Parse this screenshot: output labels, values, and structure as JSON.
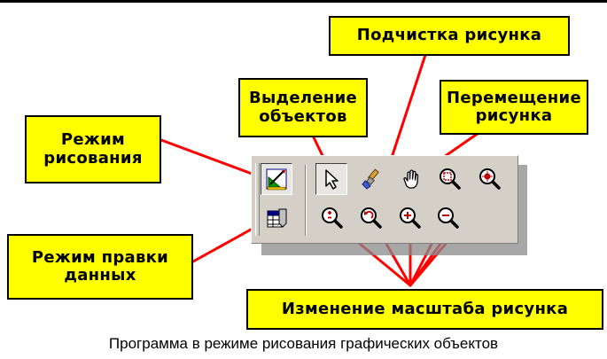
{
  "callouts": {
    "drawing_mode": [
      "Режим",
      "рисования"
    ],
    "select_objects": [
      "Выделение",
      "объектов"
    ],
    "cleanup": [
      "Подчистка рисунка"
    ],
    "move": [
      "Перемещение",
      "рисунка"
    ],
    "edit_data": [
      "Режим правки",
      "данных"
    ],
    "zoom": [
      "Изменение масштаба рисунка"
    ]
  },
  "caption": "Программа в режиме рисования графических объектов",
  "toolbar": {
    "buttons": [
      {
        "icon": "drawing-mode-icon",
        "pressed": true
      },
      {
        "icon": "select-arrow-icon",
        "pressed": true
      },
      {
        "icon": "eraser-brush-icon",
        "pressed": false
      },
      {
        "icon": "hand-pan-icon",
        "pressed": false
      },
      {
        "icon": "zoom-window-icon",
        "pressed": false
      },
      {
        "icon": "zoom-center-icon",
        "pressed": false
      },
      {
        "icon": "data-edit-icon",
        "pressed": false
      },
      {
        "icon": "zoom-all-icon",
        "pressed": false
      },
      {
        "icon": "zoom-previous-icon",
        "pressed": false
      },
      {
        "icon": "zoom-in-icon",
        "pressed": false
      },
      {
        "icon": "zoom-out-icon",
        "pressed": false
      }
    ]
  },
  "colors": {
    "callout_bg": "#ffff00",
    "leader_line": "#ff0000",
    "toolbar_bg": "#d4d0c8"
  }
}
